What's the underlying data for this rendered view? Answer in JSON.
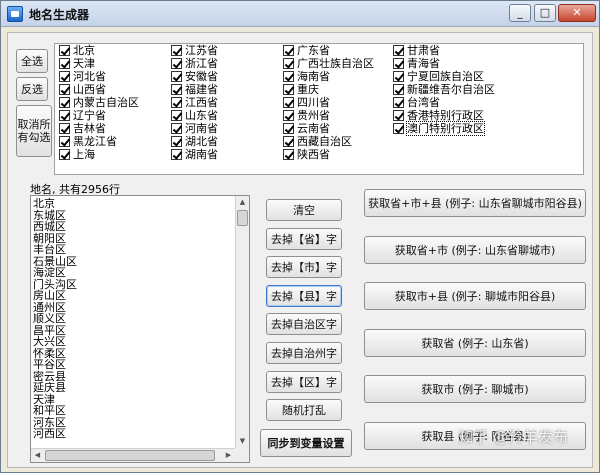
{
  "window": {
    "title": "地名生成器",
    "min": "_",
    "max": "□",
    "close": "✕"
  },
  "select_buttons": {
    "select_all": "全选",
    "invert": "反选",
    "clear_check_1": "取消所",
    "clear_check_2": "有勾选"
  },
  "provinces": [
    [
      "北京",
      "天津",
      "河北省",
      "山西省",
      "内蒙古自治区",
      "辽宁省",
      "吉林省",
      "黑龙江省",
      "上海"
    ],
    [
      "江苏省",
      "浙江省",
      "安徽省",
      "福建省",
      "江西省",
      "山东省",
      "河南省",
      "湖北省",
      "湖南省"
    ],
    [
      "广东省",
      "广西壮族自治区",
      "海南省",
      "重庆",
      "四川省",
      "贵州省",
      "云南省",
      "西藏自治区",
      "陕西省"
    ],
    [
      "甘肃省",
      "青海省",
      "宁夏回族自治区",
      "新疆维吾尔自治区",
      "台湾省",
      "香港特别行政区",
      "澳门特别行政区"
    ]
  ],
  "list": {
    "count_label": "地名, 共有2956行",
    "items": [
      "北京",
      "东城区",
      "西城区",
      "朝阳区",
      "丰台区",
      "石景山区",
      "海淀区",
      "门头沟区",
      "房山区",
      "通州区",
      "顺义区",
      "昌平区",
      "大兴区",
      "怀柔区",
      "平谷区",
      "密云县",
      "延庆县",
      "天津",
      "和平区",
      "河东区",
      "河西区"
    ]
  },
  "mid_buttons": [
    "清空",
    "去掉【省】字",
    "去掉【市】字",
    "去掉【县】字",
    "去掉自治区字",
    "去掉自治州字",
    "去掉【区】字",
    "随机打乱",
    "同步到变量设置"
  ],
  "right_buttons": [
    "获取省+市+县 (例子: 山东省聊城市阳谷县)",
    "获取省+市 (例子: 山东省聊城市)",
    "获取市+县 (例子: 聊城市阳谷县)",
    "获取省 (例子: 山东省)",
    "获取市 (例子: 聊城市)",
    "获取县 (例子: 阳谷县)"
  ],
  "watermark": "知乎 @羚羊发布"
}
